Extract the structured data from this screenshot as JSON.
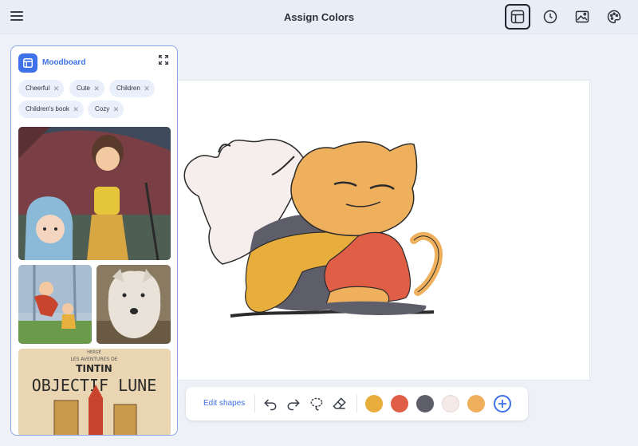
{
  "header": {
    "title": "Assign Colors",
    "menu_icon": "hamburger-icon",
    "tools": [
      {
        "name": "layout-icon",
        "active": true
      },
      {
        "name": "clock-icon",
        "active": false
      },
      {
        "name": "image-icon",
        "active": false
      },
      {
        "name": "palette-icon",
        "active": false
      }
    ]
  },
  "moodboard": {
    "title": "Moodboard",
    "tags": [
      "Cheerful",
      "Cute",
      "Children",
      "Children's book",
      "Cozy"
    ],
    "images": [
      {
        "name": "anime-umbrella-image"
      },
      {
        "name": "kids-running-image"
      },
      {
        "name": "wolf-image"
      },
      {
        "name": "tintin-cover-image",
        "text_top": "HERGÉ",
        "text_series": "LES AVENTURES DE",
        "text_hero": "TINTIN",
        "text_main": "OBJECTIF LUNE"
      }
    ]
  },
  "toolbar": {
    "edit_shapes_label": "Edit shapes",
    "colors": [
      "#E8AE3C",
      "#DF5E45",
      "#5E5E6B",
      "#F5EAE8",
      "#EFB05E"
    ],
    "accent": "#3F72E8"
  }
}
